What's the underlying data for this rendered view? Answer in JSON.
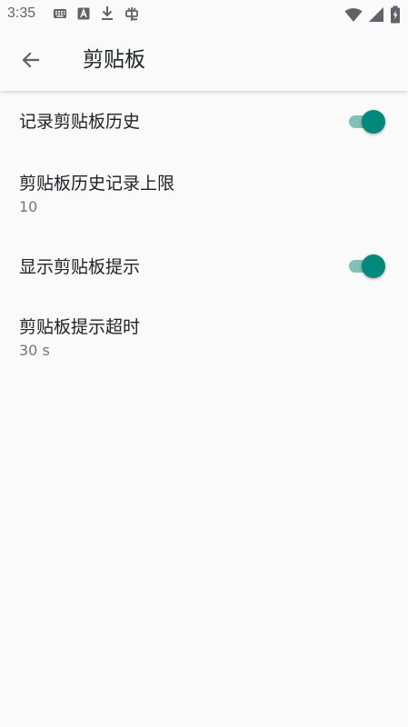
{
  "status_bar": {
    "time": "3:35",
    "left_icons": [
      "keyboard-icon",
      "a-icon",
      "download-icon",
      "bug-icon"
    ],
    "right_icons": [
      "wifi-icon",
      "cell-signal-icon",
      "battery-charging-icon"
    ]
  },
  "app_bar": {
    "back_icon": "arrow-left-icon",
    "title": "剪贴板"
  },
  "colors": {
    "accent": "#00897b",
    "track": "#80c1b9",
    "background": "#fafafa",
    "title_text": "#202124",
    "summary_text": "#757575"
  },
  "preferences": [
    {
      "title": "记录剪贴板历史",
      "summary": "",
      "has_switch": true,
      "switch_on": true
    },
    {
      "title": "剪贴板历史记录上限",
      "summary": "10",
      "has_switch": false
    },
    {
      "title": "显示剪贴板提示",
      "summary": "",
      "has_switch": true,
      "switch_on": true
    },
    {
      "title": "剪贴板提示超时",
      "summary": "30 s",
      "has_switch": false
    }
  ]
}
